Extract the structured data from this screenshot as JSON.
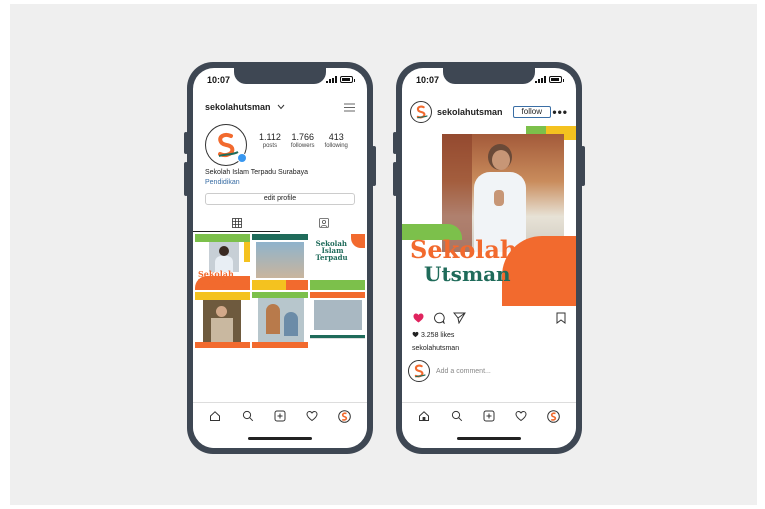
{
  "status": {
    "time": "10:07"
  },
  "profile": {
    "username": "sekolahutsman",
    "stats": [
      {
        "count": "1.112",
        "label": "posts"
      },
      {
        "count": "1.766",
        "label": "followers"
      },
      {
        "count": "413",
        "label": "following"
      }
    ],
    "bio_name": "Sekolah Islam Terpadu Surabaya",
    "bio_category": "Pendidikan",
    "edit_label": "edit profile",
    "grid_texts": {
      "tile1": "Sekolah Utsman",
      "tile3_l1": "Sekolah",
      "tile3_l2": "Islam",
      "tile3_l3": "Terpadu"
    }
  },
  "post": {
    "username": "sekolahutsman",
    "follow_label": "follow",
    "image_line1": "Sekolah",
    "image_line2": "Utsman",
    "likes": "3.258 likes",
    "caption": "sekolahutsman",
    "comment_placeholder": "Add a comment..."
  },
  "colors": {
    "phone": "#3e4753",
    "accent_orange": "#f26a2e",
    "accent_green": "#7cc04b",
    "accent_yellow": "#f4c21f",
    "teal": "#1f6b5a",
    "verified": "#3897f0",
    "like_red": "#e0245e"
  }
}
